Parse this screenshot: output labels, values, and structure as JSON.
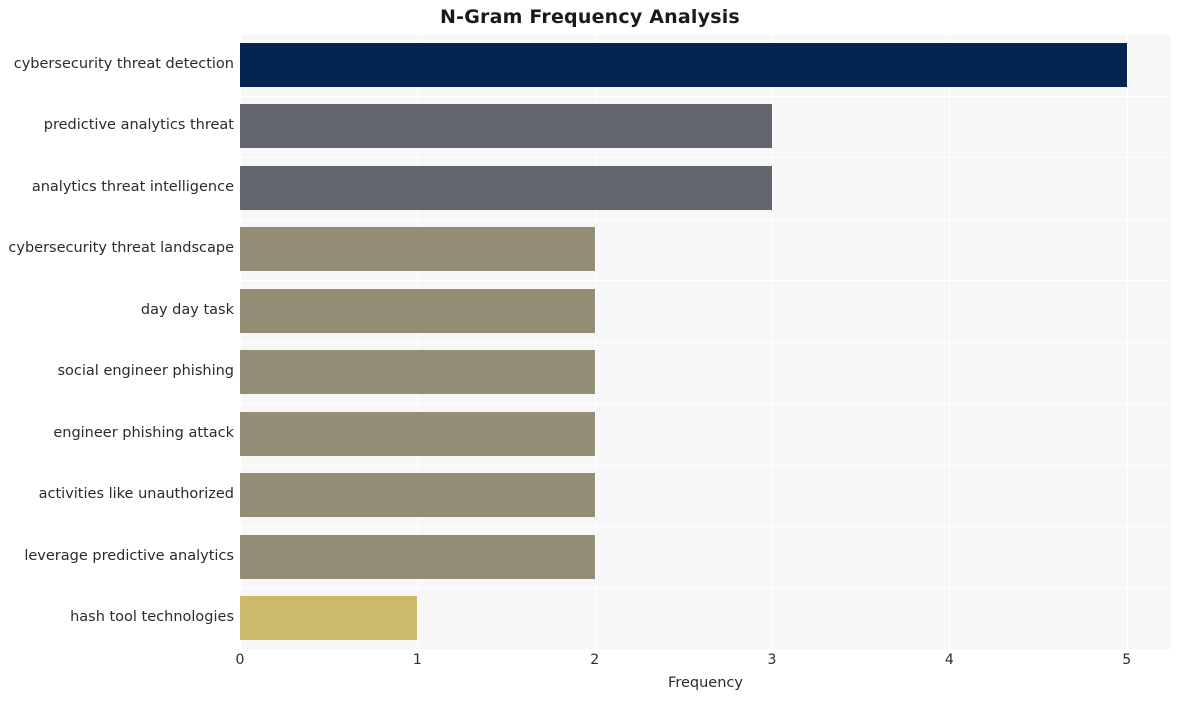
{
  "chart_data": {
    "type": "bar",
    "orientation": "horizontal",
    "title": "N-Gram Frequency Analysis",
    "xlabel": "Frequency",
    "ylabel": "",
    "categories": [
      "cybersecurity threat detection",
      "predictive analytics threat",
      "analytics threat intelligence",
      "cybersecurity threat landscape",
      "day day task",
      "social engineer phishing",
      "engineer phishing attack",
      "activities like unauthorized",
      "leverage predictive analytics",
      "hash tool technologies"
    ],
    "values": [
      5,
      3,
      3,
      2,
      2,
      2,
      2,
      2,
      2,
      1
    ],
    "bar_colors": [
      "#05244f",
      "#63666e",
      "#63666e",
      "#948e77",
      "#948e77",
      "#948e77",
      "#948e77",
      "#948e77",
      "#948e77",
      "#ccb96b"
    ],
    "xlim": [
      0,
      5.25
    ],
    "xticks": [
      0,
      1,
      2,
      3,
      4,
      5
    ],
    "xtick_labels": [
      "0",
      "1",
      "2",
      "3",
      "4",
      "5"
    ],
    "grid": true,
    "grid_color": "#ffffff",
    "plot_background": "#f7f7f7",
    "figure_background": "#ffffff",
    "legend": null
  }
}
